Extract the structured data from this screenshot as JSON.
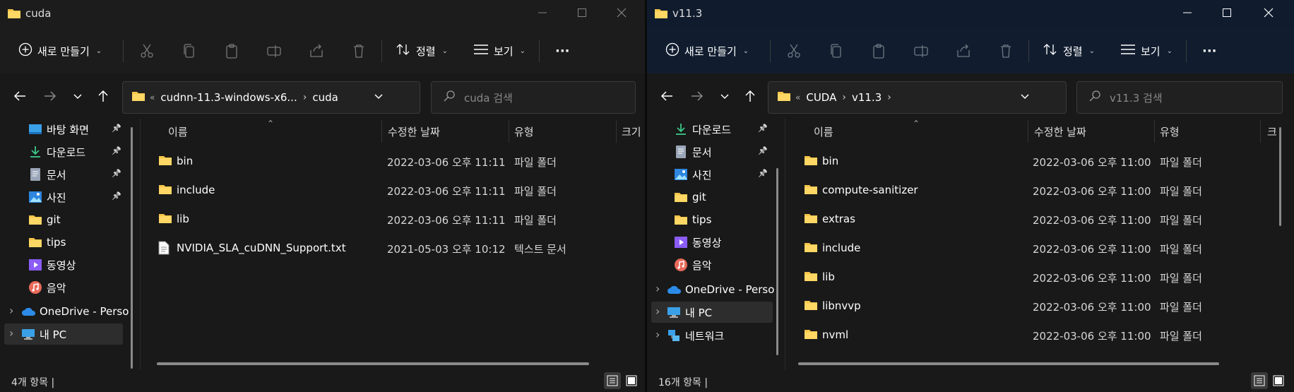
{
  "colors": {
    "folder": "#F6C54A",
    "accent": "#3B8EEA"
  },
  "left": {
    "title": "cuda",
    "toolbar": {
      "new_label": "새로 만들기",
      "sort_label": "정렬",
      "view_label": "보기",
      "more_label": "···"
    },
    "address": {
      "lt": "«",
      "crumbs": [
        "cudnn-11.3-windows-x6...",
        "cuda"
      ]
    },
    "search_placeholder": "cuda 검색",
    "nav_items": [
      {
        "label": "바탕 화면",
        "icon": "desktop-icon",
        "pinned": true
      },
      {
        "label": "다운로드",
        "icon": "download-icon",
        "pinned": true
      },
      {
        "label": "문서",
        "icon": "document-icon",
        "pinned": true
      },
      {
        "label": "사진",
        "icon": "pictures-icon",
        "pinned": true
      },
      {
        "label": "git",
        "icon": "folder-icon",
        "pinned": false
      },
      {
        "label": "tips",
        "icon": "folder-icon",
        "pinned": false
      },
      {
        "label": "동영상",
        "icon": "video-icon",
        "pinned": false
      },
      {
        "label": "음악",
        "icon": "music-icon",
        "pinned": false
      },
      {
        "label": "OneDrive - Perso",
        "icon": "onedrive-icon",
        "pinned": false
      },
      {
        "label": "내 PC",
        "icon": "pc-icon",
        "pinned": false
      }
    ],
    "columns": {
      "name": "이름",
      "date": "수정한 날짜",
      "type": "유형",
      "size": "크기"
    },
    "files": [
      {
        "name": "bin",
        "date": "2022-03-06 오후 11:11",
        "type": "파일 폴더",
        "icon": "folder-icon"
      },
      {
        "name": "include",
        "date": "2022-03-06 오후 11:11",
        "type": "파일 폴더",
        "icon": "folder-icon"
      },
      {
        "name": "lib",
        "date": "2022-03-06 오후 11:11",
        "type": "파일 폴더",
        "icon": "folder-icon"
      },
      {
        "name": "NVIDIA_SLA_cuDNN_Support.txt",
        "date": "2021-05-03 오후 10:12",
        "type": "텍스트 문서",
        "icon": "text-file-icon"
      }
    ],
    "status": "4개 항목  |"
  },
  "right": {
    "title": "v11.3",
    "toolbar": {
      "new_label": "새로 만들기",
      "sort_label": "정렬",
      "view_label": "보기",
      "more_label": "···"
    },
    "address": {
      "lt": "«",
      "crumbs": [
        "CUDA",
        "v11.3"
      ]
    },
    "search_placeholder": "v11.3 검색",
    "nav_items": [
      {
        "label": "다운로드",
        "icon": "download-icon",
        "pinned": true
      },
      {
        "label": "문서",
        "icon": "document-icon",
        "pinned": true
      },
      {
        "label": "사진",
        "icon": "pictures-icon",
        "pinned": true
      },
      {
        "label": "git",
        "icon": "folder-icon",
        "pinned": false
      },
      {
        "label": "tips",
        "icon": "folder-icon",
        "pinned": false
      },
      {
        "label": "동영상",
        "icon": "video-icon",
        "pinned": false
      },
      {
        "label": "음악",
        "icon": "music-icon",
        "pinned": false
      },
      {
        "label": "OneDrive - Perso",
        "icon": "onedrive-icon",
        "pinned": false
      },
      {
        "label": "내 PC",
        "icon": "pc-icon",
        "pinned": false
      },
      {
        "label": "네트워크",
        "icon": "network-icon",
        "pinned": false
      }
    ],
    "columns": {
      "name": "이름",
      "date": "수정한 날짜",
      "type": "유형",
      "size": "크"
    },
    "files": [
      {
        "name": "bin",
        "date": "2022-03-06 오후 11:00",
        "type": "파일 폴더",
        "icon": "folder-icon"
      },
      {
        "name": "compute-sanitizer",
        "date": "2022-03-06 오후 11:00",
        "type": "파일 폴더",
        "icon": "folder-icon"
      },
      {
        "name": "extras",
        "date": "2022-03-06 오후 11:00",
        "type": "파일 폴더",
        "icon": "folder-icon"
      },
      {
        "name": "include",
        "date": "2022-03-06 오후 11:00",
        "type": "파일 폴더",
        "icon": "folder-icon"
      },
      {
        "name": "lib",
        "date": "2022-03-06 오후 11:00",
        "type": "파일 폴더",
        "icon": "folder-icon"
      },
      {
        "name": "libnvvp",
        "date": "2022-03-06 오후 11:00",
        "type": "파일 폴더",
        "icon": "folder-icon"
      },
      {
        "name": "nvml",
        "date": "2022-03-06 오후 11:00",
        "type": "파일 폴더",
        "icon": "folder-icon"
      }
    ],
    "status": "16개 항목  |"
  }
}
